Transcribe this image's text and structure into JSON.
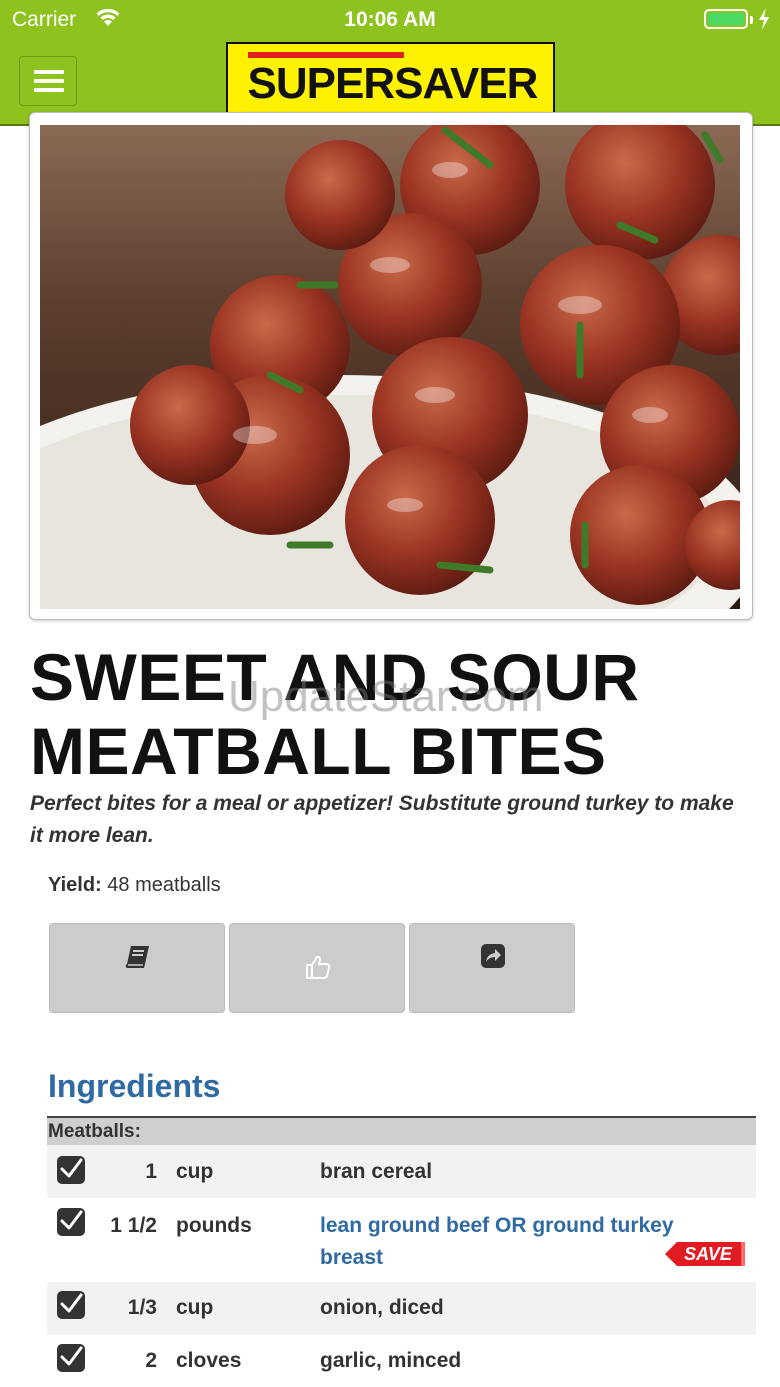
{
  "status_bar": {
    "carrier": "Carrier",
    "time": "10:06 AM",
    "battery_level_percent": 90
  },
  "header": {
    "logo_text": "SUPERSAVER",
    "brand_colors": {
      "bar": "#8dc21f",
      "logo_bg": "#fff200",
      "logo_accent": "#e0201b"
    }
  },
  "recipe": {
    "title_line1": "SWEET AND SOUR",
    "title_line2": "MEATBALL BITES",
    "watermark": "UpdateStar.com",
    "description": "Perfect bites for a meal or appetizer! Substitute ground turkey to make it more lean.",
    "yield_label": "Yield:",
    "yield_value": "48 meatballs",
    "actions": [
      {
        "icon": "book-icon"
      },
      {
        "icon": "thumbs-up-icon"
      },
      {
        "icon": "share-icon"
      }
    ]
  },
  "ingredients": {
    "heading": "Ingredients",
    "section": "Meatballs:",
    "items": [
      {
        "checked": true,
        "qty": "1",
        "unit": "cup",
        "name": "bran cereal",
        "link": false,
        "save": false
      },
      {
        "checked": true,
        "qty": "1 1/2",
        "unit": "pounds",
        "name": "lean ground beef OR ground turkey breast",
        "link": true,
        "save": true,
        "save_label": "SAVE"
      },
      {
        "checked": true,
        "qty": "1/3",
        "unit": "cup",
        "name": "onion, diced",
        "link": false,
        "save": false
      },
      {
        "checked": true,
        "qty": "2",
        "unit": "cloves",
        "name": "garlic, minced",
        "link": false,
        "save": false
      }
    ]
  }
}
